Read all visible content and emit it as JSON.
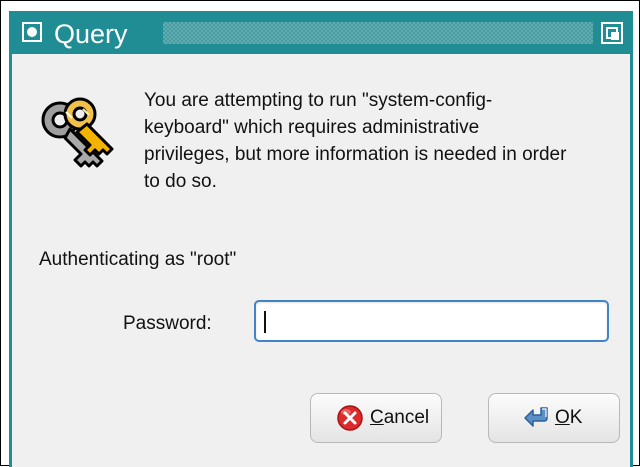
{
  "window": {
    "title": "Query"
  },
  "dialog": {
    "message": "You are attempting to run \"system-config-\nkeyboard\" which requires administrative\nprivileges, but more information is needed in order\nto do so.",
    "authenticating_text": "Authenticating as \"root\"",
    "password_label": "Password:",
    "password_value": ""
  },
  "buttons": {
    "cancel": {
      "mnemonic": "C",
      "rest": "ancel"
    },
    "ok": {
      "mnemonic": "O",
      "rest": "K"
    }
  },
  "icons": {
    "dialog_icon": "keys-icon",
    "cancel_icon": "cancel-icon",
    "ok_icon": "ok-arrow-icon",
    "titlebar_left": "window-menu-icon",
    "titlebar_right": "maximize-icon"
  },
  "colors": {
    "titlebar": "#1f8d93",
    "field_border": "#3f85c8",
    "cancel_red": "#dd2a2a",
    "ok_blue": "#5a90c8"
  }
}
